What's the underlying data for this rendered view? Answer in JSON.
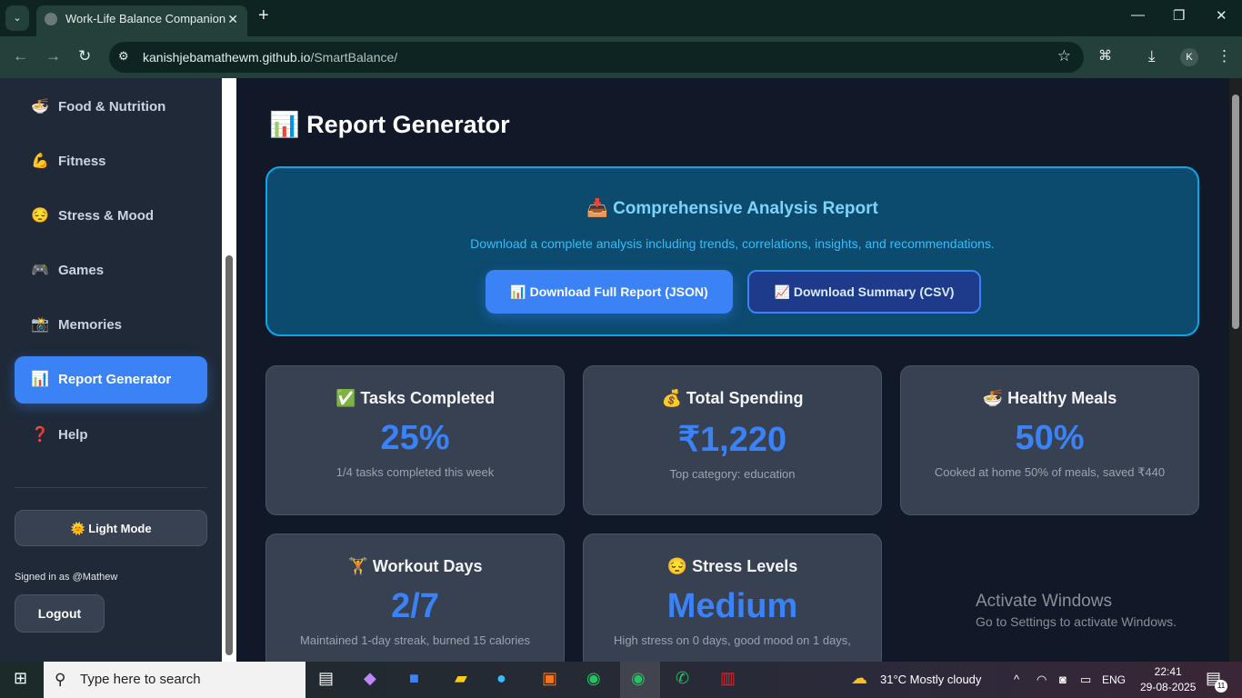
{
  "browser": {
    "tab_title": "Work-Life Balance Companion",
    "url_host": "kanishjebamathewm.github.io",
    "url_path": "/SmartBalance/",
    "profile_initial": "K"
  },
  "sidebar": {
    "items": [
      {
        "icon": "🍜",
        "label": "Food & Nutrition"
      },
      {
        "icon": "💪",
        "label": "Fitness"
      },
      {
        "icon": "😔",
        "label": "Stress & Mood"
      },
      {
        "icon": "🎮",
        "label": "Games"
      },
      {
        "icon": "📸",
        "label": "Memories"
      },
      {
        "icon": "📊",
        "label": "Report Generator",
        "active": true
      },
      {
        "icon": "❓",
        "label": "Help"
      }
    ],
    "light_mode": "🌞 Light Mode",
    "signed_in": "Signed in as @Mathew",
    "logout": "Logout"
  },
  "main": {
    "title": "📊 Report Generator",
    "hero": {
      "title": "📥 Comprehensive Analysis Report",
      "desc": "Download a complete analysis including trends, correlations, insights, and recommendations.",
      "btn_json": "📊 Download Full Report (JSON)",
      "btn_csv": "📈 Download Summary (CSV)"
    },
    "cards": [
      {
        "title": "✅ Tasks Completed",
        "value": "25%",
        "sub": "1/4 tasks completed this week"
      },
      {
        "title": "💰 Total Spending",
        "value": "₹1,220",
        "sub": "Top category: education"
      },
      {
        "title": "🍜 Healthy Meals",
        "value": "50%",
        "sub": "Cooked at home 50% of meals, saved ₹440"
      },
      {
        "title": "🏋️ Workout Days",
        "value": "2/7",
        "sub": "Maintained 1-day streak, burned 15 calories"
      },
      {
        "title": "😔 Stress Levels",
        "value": "Medium",
        "sub": "High stress on 0 days, good mood on 1 days,"
      }
    ]
  },
  "watermark": {
    "line1": "Activate Windows",
    "line2": "Go to Settings to activate Windows."
  },
  "taskbar": {
    "search": "Type here to search",
    "weather": "31°C  Mostly cloudy",
    "lang": "ENG",
    "time": "22:41",
    "date": "29-08-2025",
    "notif": "11"
  },
  "colors": {
    "accent": "#3b82f6",
    "hero_border": "#0ea5e9"
  }
}
